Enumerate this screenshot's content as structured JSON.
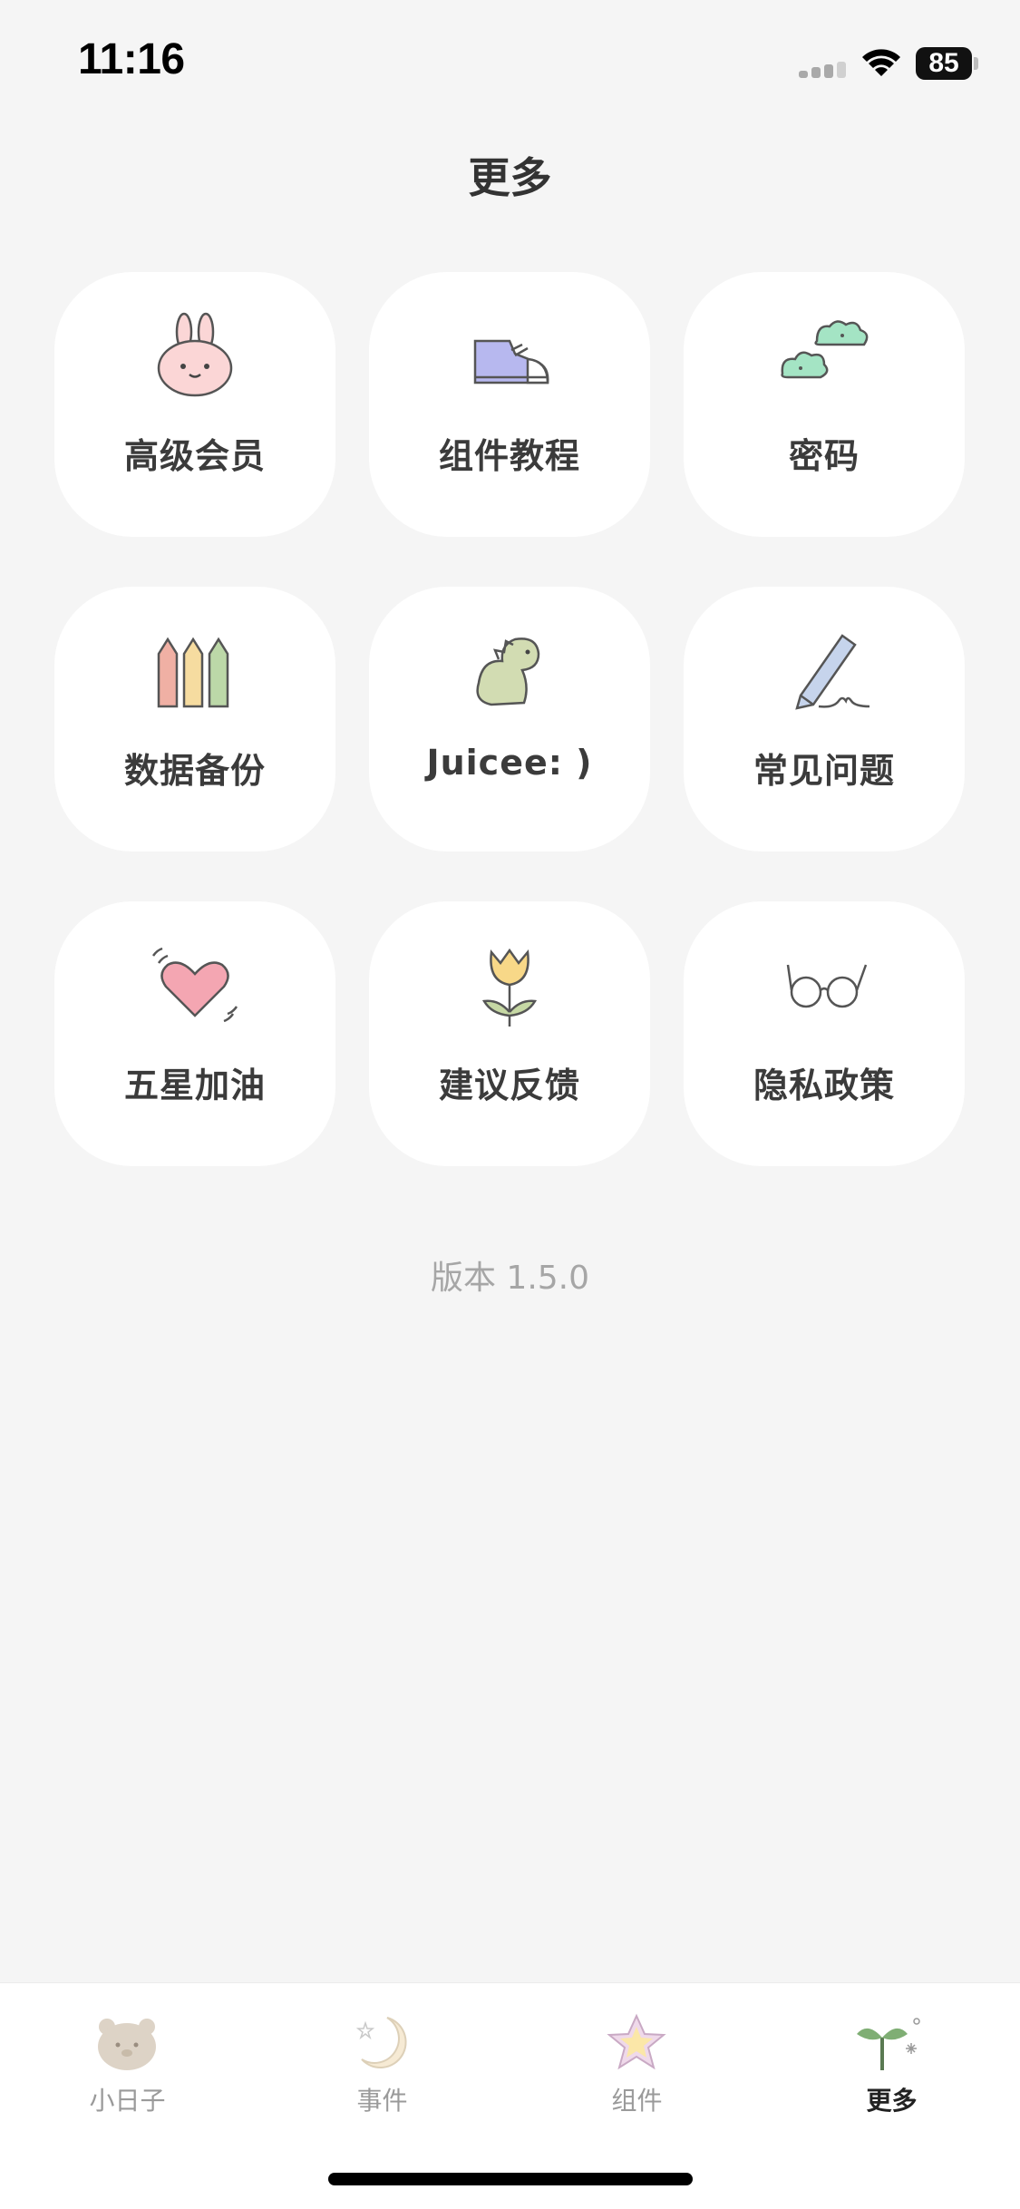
{
  "status_bar": {
    "time": "11:16",
    "battery": "85"
  },
  "page": {
    "title": "更多"
  },
  "menu": [
    {
      "label": "高级会员",
      "icon": "bunny-icon"
    },
    {
      "label": "组件教程",
      "icon": "sneaker-icon"
    },
    {
      "label": "密码",
      "icon": "bush-icon"
    },
    {
      "label": "数据备份",
      "icon": "pencils-icon"
    },
    {
      "label": "Juicee: )",
      "icon": "dinosaur-icon"
    },
    {
      "label": "常见问题",
      "icon": "pencil-icon"
    },
    {
      "label": "五星加油",
      "icon": "heart-icon"
    },
    {
      "label": "建议反馈",
      "icon": "tulip-icon"
    },
    {
      "label": "隐私政策",
      "icon": "glasses-icon"
    }
  ],
  "version": "版本 1.5.0",
  "tabs": [
    {
      "label": "小日子",
      "icon": "bear-icon",
      "active": false
    },
    {
      "label": "事件",
      "icon": "moon-icon",
      "active": false
    },
    {
      "label": "组件",
      "icon": "star-icon",
      "active": false
    },
    {
      "label": "更多",
      "icon": "sprout-icon",
      "active": true
    }
  ],
  "colors": {
    "background": "#f5f5f5",
    "card": "#ffffff",
    "text": "#3b3b3b",
    "muted": "#a6a6a6",
    "active_tab": "#222222"
  }
}
